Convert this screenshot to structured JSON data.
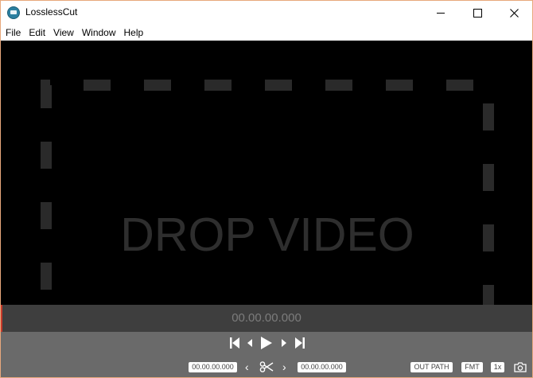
{
  "window": {
    "title": "LosslessCut"
  },
  "menu": [
    "File",
    "Edit",
    "View",
    "Window",
    "Help"
  ],
  "stage": {
    "drop_text": "DROP VIDEO"
  },
  "timeline": {
    "current_time": "00.00.00.000"
  },
  "controls": {
    "cut_start": "00.00.00.000",
    "cut_end": "00.00.00.000",
    "out_path_label": "OUT PATH",
    "format_label": "FMT",
    "speed_label": "1x"
  },
  "icons": {
    "app": "lossless-cut-icon",
    "jump_start": "skip-to-start-icon",
    "step_back": "step-back-icon",
    "play": "play-icon",
    "step_forward": "step-forward-icon",
    "jump_end": "skip-to-end-icon",
    "cut": "scissors-icon",
    "capture": "camera-icon"
  },
  "colors": {
    "stage_bg": "#000000",
    "timeline_bg": "#3e3e3e",
    "controls_bg": "#6a6a6a",
    "cursor": "#c83a2a"
  }
}
